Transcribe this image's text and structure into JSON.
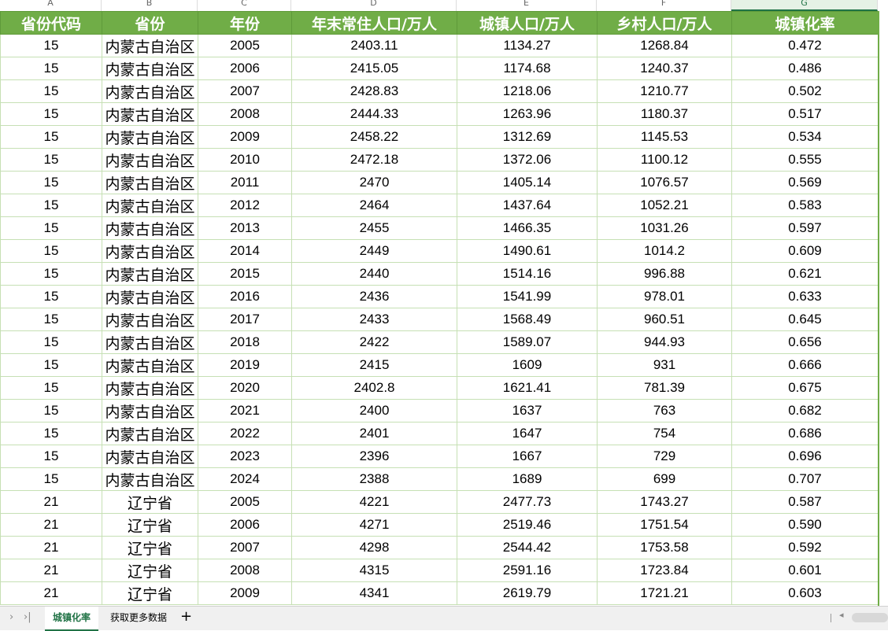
{
  "columns": [
    "A",
    "B",
    "C",
    "D",
    "E",
    "F",
    "G"
  ],
  "active_column": "G",
  "headers": [
    "省份代码",
    "省份",
    "年份",
    "年末常住人口/万人",
    "城镇人口/万人",
    "乡村人口/万人",
    "城镇化率"
  ],
  "rows": [
    [
      "15",
      "内蒙古自治区",
      "2005",
      "2403.11",
      "1134.27",
      "1268.84",
      "0.472"
    ],
    [
      "15",
      "内蒙古自治区",
      "2006",
      "2415.05",
      "1174.68",
      "1240.37",
      "0.486"
    ],
    [
      "15",
      "内蒙古自治区",
      "2007",
      "2428.83",
      "1218.06",
      "1210.77",
      "0.502"
    ],
    [
      "15",
      "内蒙古自治区",
      "2008",
      "2444.33",
      "1263.96",
      "1180.37",
      "0.517"
    ],
    [
      "15",
      "内蒙古自治区",
      "2009",
      "2458.22",
      "1312.69",
      "1145.53",
      "0.534"
    ],
    [
      "15",
      "内蒙古自治区",
      "2010",
      "2472.18",
      "1372.06",
      "1100.12",
      "0.555"
    ],
    [
      "15",
      "内蒙古自治区",
      "2011",
      "2470",
      "1405.14",
      "1076.57",
      "0.569"
    ],
    [
      "15",
      "内蒙古自治区",
      "2012",
      "2464",
      "1437.64",
      "1052.21",
      "0.583"
    ],
    [
      "15",
      "内蒙古自治区",
      "2013",
      "2455",
      "1466.35",
      "1031.26",
      "0.597"
    ],
    [
      "15",
      "内蒙古自治区",
      "2014",
      "2449",
      "1490.61",
      "1014.2",
      "0.609"
    ],
    [
      "15",
      "内蒙古自治区",
      "2015",
      "2440",
      "1514.16",
      "996.88",
      "0.621"
    ],
    [
      "15",
      "内蒙古自治区",
      "2016",
      "2436",
      "1541.99",
      "978.01",
      "0.633"
    ],
    [
      "15",
      "内蒙古自治区",
      "2017",
      "2433",
      "1568.49",
      "960.51",
      "0.645"
    ],
    [
      "15",
      "内蒙古自治区",
      "2018",
      "2422",
      "1589.07",
      "944.93",
      "0.656"
    ],
    [
      "15",
      "内蒙古自治区",
      "2019",
      "2415",
      "1609",
      "931",
      "0.666"
    ],
    [
      "15",
      "内蒙古自治区",
      "2020",
      "2402.8",
      "1621.41",
      "781.39",
      "0.675"
    ],
    [
      "15",
      "内蒙古自治区",
      "2021",
      "2400",
      "1637",
      "763",
      "0.682"
    ],
    [
      "15",
      "内蒙古自治区",
      "2022",
      "2401",
      "1647",
      "754",
      "0.686"
    ],
    [
      "15",
      "内蒙古自治区",
      "2023",
      "2396",
      "1667",
      "729",
      "0.696"
    ],
    [
      "15",
      "内蒙古自治区",
      "2024",
      "2388",
      "1689",
      "699",
      "0.707"
    ],
    [
      "21",
      "辽宁省",
      "2005",
      "4221",
      "2477.73",
      "1743.27",
      "0.587"
    ],
    [
      "21",
      "辽宁省",
      "2006",
      "4271",
      "2519.46",
      "1751.54",
      "0.590"
    ],
    [
      "21",
      "辽宁省",
      "2007",
      "4298",
      "2544.42",
      "1753.58",
      "0.592"
    ],
    [
      "21",
      "辽宁省",
      "2008",
      "4315",
      "2591.16",
      "1723.84",
      "0.601"
    ],
    [
      "21",
      "辽宁省",
      "2009",
      "4341",
      "2619.79",
      "1721.21",
      "0.603"
    ]
  ],
  "sheet_tabs": [
    {
      "label": "城镇化率",
      "active": true
    },
    {
      "label": "获取更多数据",
      "active": false
    }
  ],
  "add_sheet_label": "+",
  "nav_prev_icon": "chevron-right-icon",
  "nav_last_icon": "chevron-last-icon",
  "colors": {
    "header_bg": "#70ad47",
    "grid_line": "#c6e0b4",
    "accent": "#217346"
  }
}
